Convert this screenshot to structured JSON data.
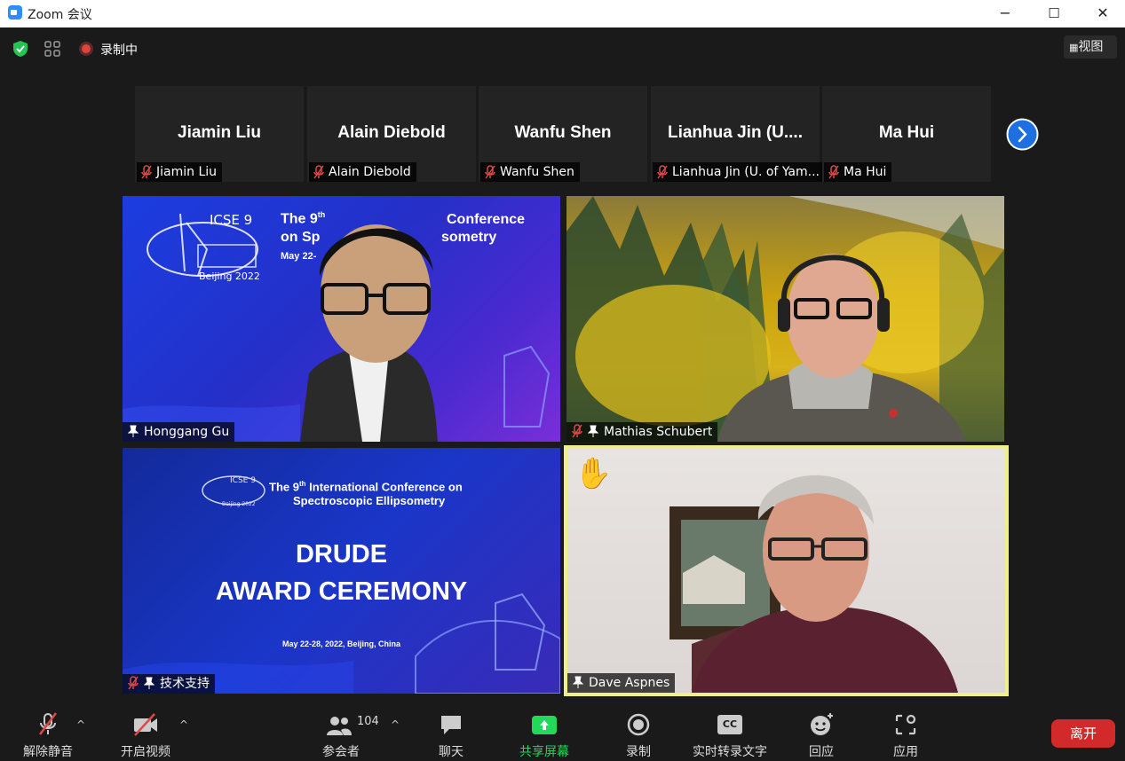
{
  "window": {
    "title": "Zoom 会议",
    "minimize": "−",
    "maximize": "☐",
    "close": "✕"
  },
  "topbar": {
    "recording_label": "录制中",
    "view_label": "视图",
    "view_icon": "grid-view-icon"
  },
  "thumbnails": [
    {
      "display": "Jiamin Liu",
      "label": "Jiamin Liu"
    },
    {
      "display": "Alain Diebold",
      "label": "Alain Diebold"
    },
    {
      "display": "Wanfu Shen",
      "label": "Wanfu Shen"
    },
    {
      "display": "Lianhua Jin (U....",
      "label": "Lianhua Jin (U. of Yam..."
    },
    {
      "display": "Ma Hui",
      "label": "Ma Hui"
    }
  ],
  "tiles": [
    {
      "name": "Honggang Gu"
    },
    {
      "name": "Mathias Schubert"
    },
    {
      "name": "技术支持"
    },
    {
      "name": "Dave Aspnes"
    }
  ],
  "slide1": {
    "logo": "ICSE 9",
    "logo_sub": "Beijing 2022",
    "line1": "The 9",
    "sup": "th",
    "line1b": "Conference",
    "line2": "on Sp",
    "line2b": "sometry",
    "line3": "May 22-"
  },
  "slide2": {
    "logo": "ICSE 9",
    "logo_sub": "Beijing 2022",
    "heading": "The 9",
    "sup": "th",
    "heading_rest": " International Conference on",
    "heading2": "Spectroscopic Ellipsometry",
    "title1": "DRUDE",
    "title2": "AWARD CEREMONY",
    "date": "May 22-28, 2022, Beijing, China"
  },
  "raised_hand": "✋",
  "toolbar": {
    "unmute": "解除静音",
    "video": "开启视频",
    "participants": "参会者",
    "participants_count": "104",
    "chat": "聊天",
    "share": "共享屏幕",
    "record": "录制",
    "captions": "实时转录文字",
    "captions_icon_text": "CC",
    "reactions": "回应",
    "apps": "应用",
    "leave": "离开"
  },
  "colors": {
    "share_green": "#23d959",
    "leave_red": "#d22a2a",
    "active_speaker": "#f0f08a",
    "next_blue": "#1e6fe0"
  }
}
